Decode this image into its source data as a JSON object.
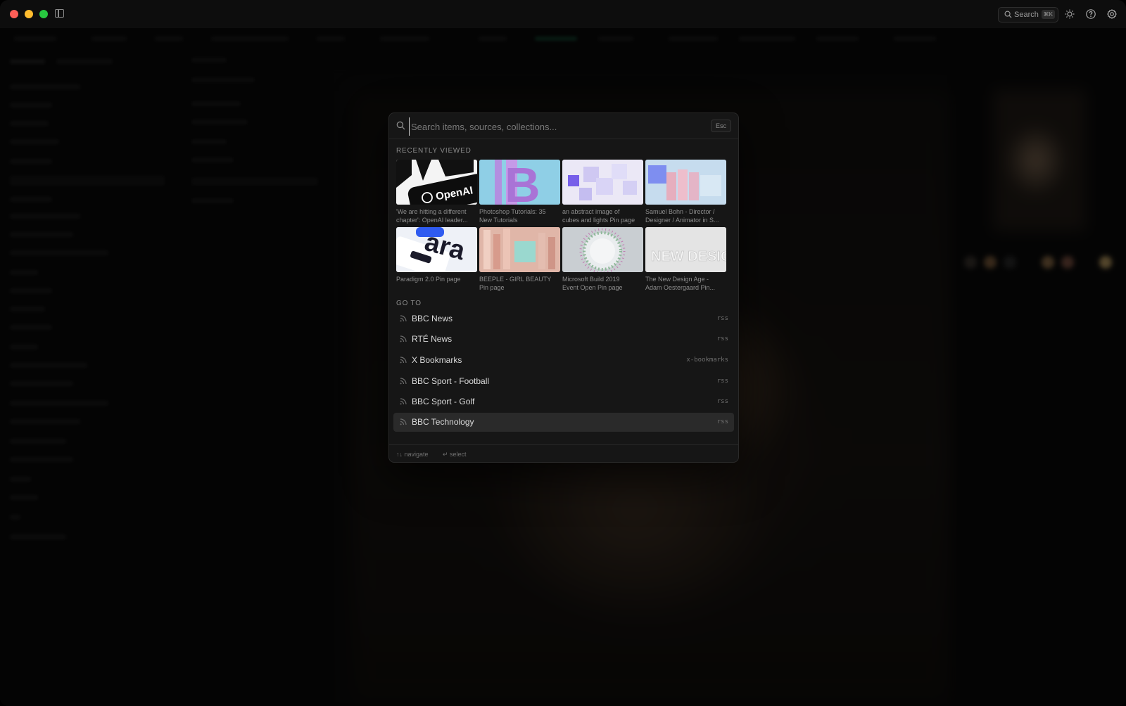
{
  "topbar": {
    "search_label": "Search",
    "search_shortcut": "⌘K"
  },
  "palette": {
    "search_placeholder": "Search items, sources, collections...",
    "esc_label": "Esc",
    "recent_title": "RECENTLY VIEWED",
    "recent_items": [
      {
        "line1": "'We are hitting a different",
        "line2": "chapter': OpenAI leader...",
        "thumb_text": "OpenAI"
      },
      {
        "line1": "Photoshop Tutorials: 35",
        "line2": "New Tutorials",
        "thumb_text": "B"
      },
      {
        "line1": "an abstract image of",
        "line2": "cubes and lights Pin page",
        "thumb_text": ""
      },
      {
        "line1": "Samuel Bohn - Director /",
        "line2": "Designer / Animator in S...",
        "thumb_text": ""
      },
      {
        "line1": "Paradigm 2.0 Pin page",
        "line2": "",
        "thumb_text": "ara"
      },
      {
        "line1": "BEEPLE - GIRL BEAUTY",
        "line2": "Pin page",
        "thumb_text": ""
      },
      {
        "line1": "Microsoft Build 2019",
        "line2": "Event Open Pin page",
        "thumb_text": ""
      },
      {
        "line1": "The New Design Age -",
        "line2": "Adam Oestergaard Pin...",
        "thumb_text": "NEW DESIGN"
      }
    ],
    "goto_title": "GO TO",
    "goto_items": [
      {
        "name": "BBC News",
        "tag": "rss"
      },
      {
        "name": "RTÉ News",
        "tag": "rss"
      },
      {
        "name": "X Bookmarks",
        "tag": "x-bookmarks"
      },
      {
        "name": "BBC Sport - Football",
        "tag": "rss"
      },
      {
        "name": "BBC Sport - Golf",
        "tag": "rss"
      },
      {
        "name": "BBC Technology",
        "tag": "rss"
      }
    ],
    "active_goto_index": 5,
    "footer_navigate": "↑↓ navigate",
    "footer_select": "↵ select"
  },
  "colors": {
    "traffic_red": "#fe5f57",
    "traffic_yellow": "#febc2e",
    "traffic_green": "#28c840",
    "palette_bg": "#161616",
    "active_row": "#2a2a2a"
  },
  "icons": [
    "search-icon",
    "sidebar-toggle-icon",
    "sun-icon",
    "help-icon",
    "gear-icon",
    "rss-icon"
  ]
}
